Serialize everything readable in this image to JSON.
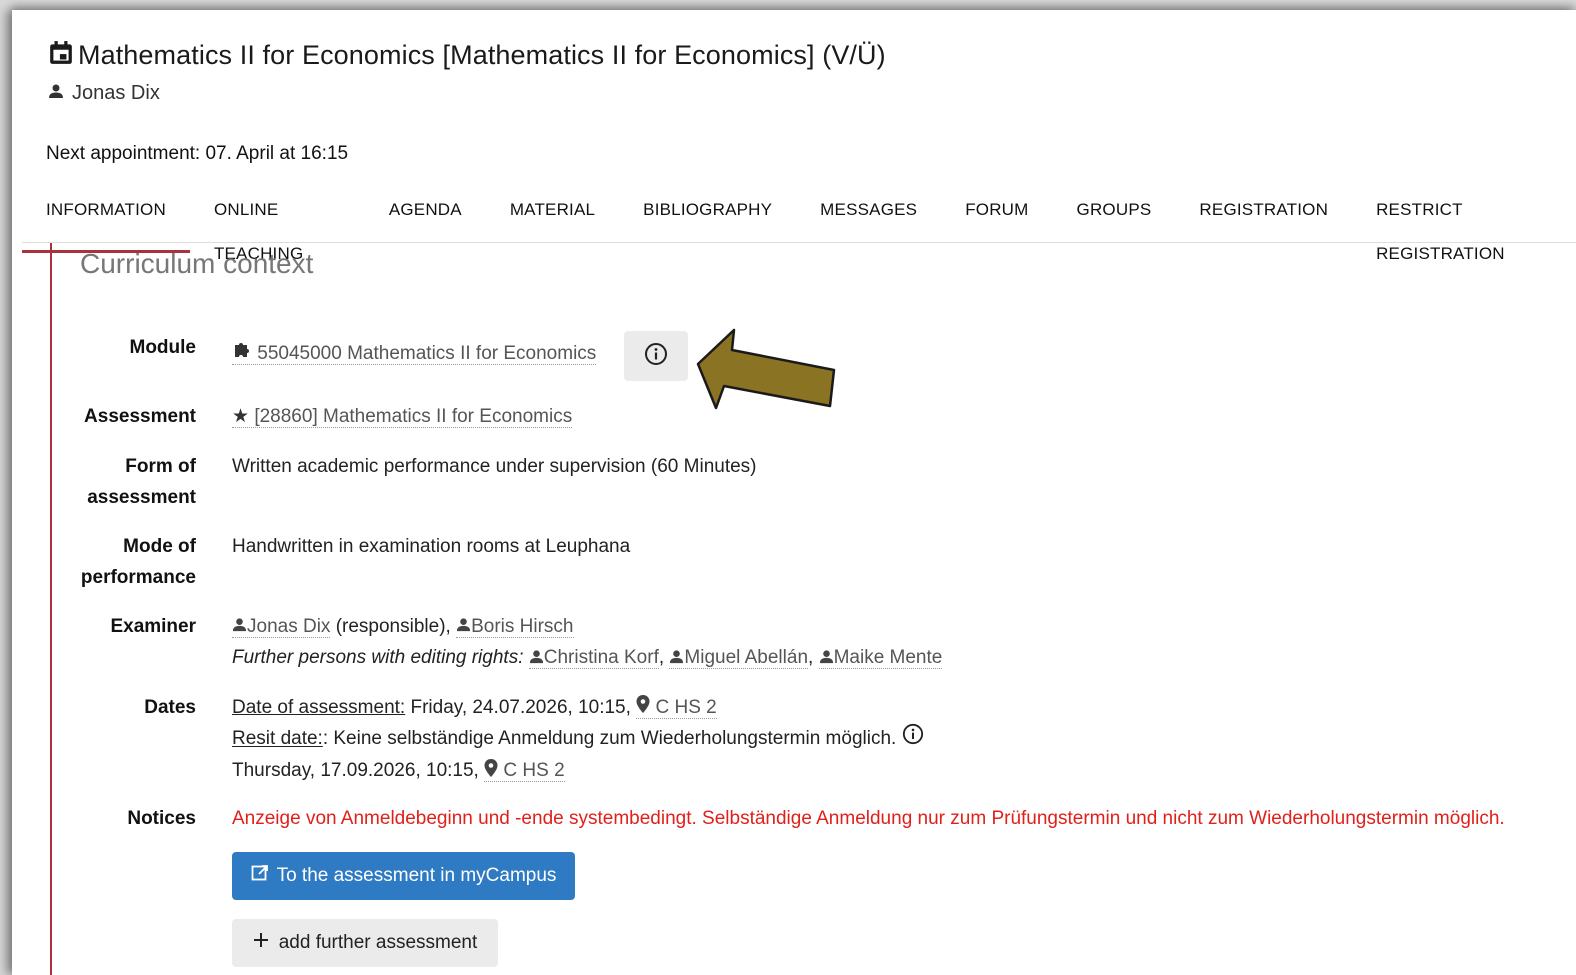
{
  "header": {
    "title": "Mathematics II for Economics [Mathematics II for Economics] (V/Ü)",
    "owner": "Jonas Dix",
    "next_appointment": "Next appointment: 07. April at 16:15"
  },
  "tabs": [
    {
      "label": "INFORMATION"
    },
    {
      "label": "ONLINE TEACHING"
    },
    {
      "label": "AGENDA"
    },
    {
      "label": "MATERIAL"
    },
    {
      "label": "BIBLIOGRAPHY"
    },
    {
      "label": "MESSAGES"
    },
    {
      "label": "FORUM"
    },
    {
      "label": "GROUPS"
    },
    {
      "label": "REGISTRATION"
    },
    {
      "label": "RESTRICT REGISTRATION"
    }
  ],
  "section": {
    "title": "Curriculum context",
    "module_label": "Module",
    "module_value": "55045000 Mathematics II for Economics",
    "assessment_label": "Assessment",
    "assessment_value": "[28860] Mathematics II for Economics",
    "form_label_1": "Form of",
    "form_label_2": "assessment",
    "form_value": "Written academic performance under supervision (60 Minutes)",
    "mode_label_1": "Mode of",
    "mode_label_2": "performance",
    "mode_value": "Handwritten in examination rooms at Leuphana",
    "examiner_label": "Examiner",
    "examiner_1": "Jonas Dix",
    "examiner_1_role": " (responsible),",
    "examiner_2": "Boris Hirsch",
    "further_label": "Further persons with editing rights:",
    "further_1": "Christina Korf",
    "further_2": "Miguel Abellán",
    "further_3": "Maike Mente",
    "comma": ",",
    "dates_label": "Dates",
    "date_assessment_label": "Date of assessment:",
    "date_assessment_value": "Friday, 24.07.2026, 10:15,",
    "room_1": "C HS 2",
    "resit_label": "Resit date:",
    "resit_value": ": Keine selbständige Anmeldung zum Wiederholungstermin möglich.",
    "resit_date": "Thursday, 17.09.2026, 10:15,",
    "room_2": "C HS 2",
    "notices_label": "Notices",
    "notices_value": "Anzeige von Anmeldebeginn und -ende systembedingt. Selbständige Anmeldung nur zum Prüfungstermin und nicht zum Wiederholungstermin möglich.",
    "btn_mycampus": "To the assessment in myCampus",
    "btn_add": "add further assessment"
  },
  "colors": {
    "accent": "#a8323e",
    "primary_button": "#2f7bc3",
    "notice_red": "#e0201b",
    "arrow": "#8a7322"
  },
  "icons": [
    "calendar-icon",
    "person-icon",
    "puzzle-icon",
    "star-icon",
    "info-icon",
    "location-icon",
    "external-link-icon",
    "plus-icon"
  ]
}
